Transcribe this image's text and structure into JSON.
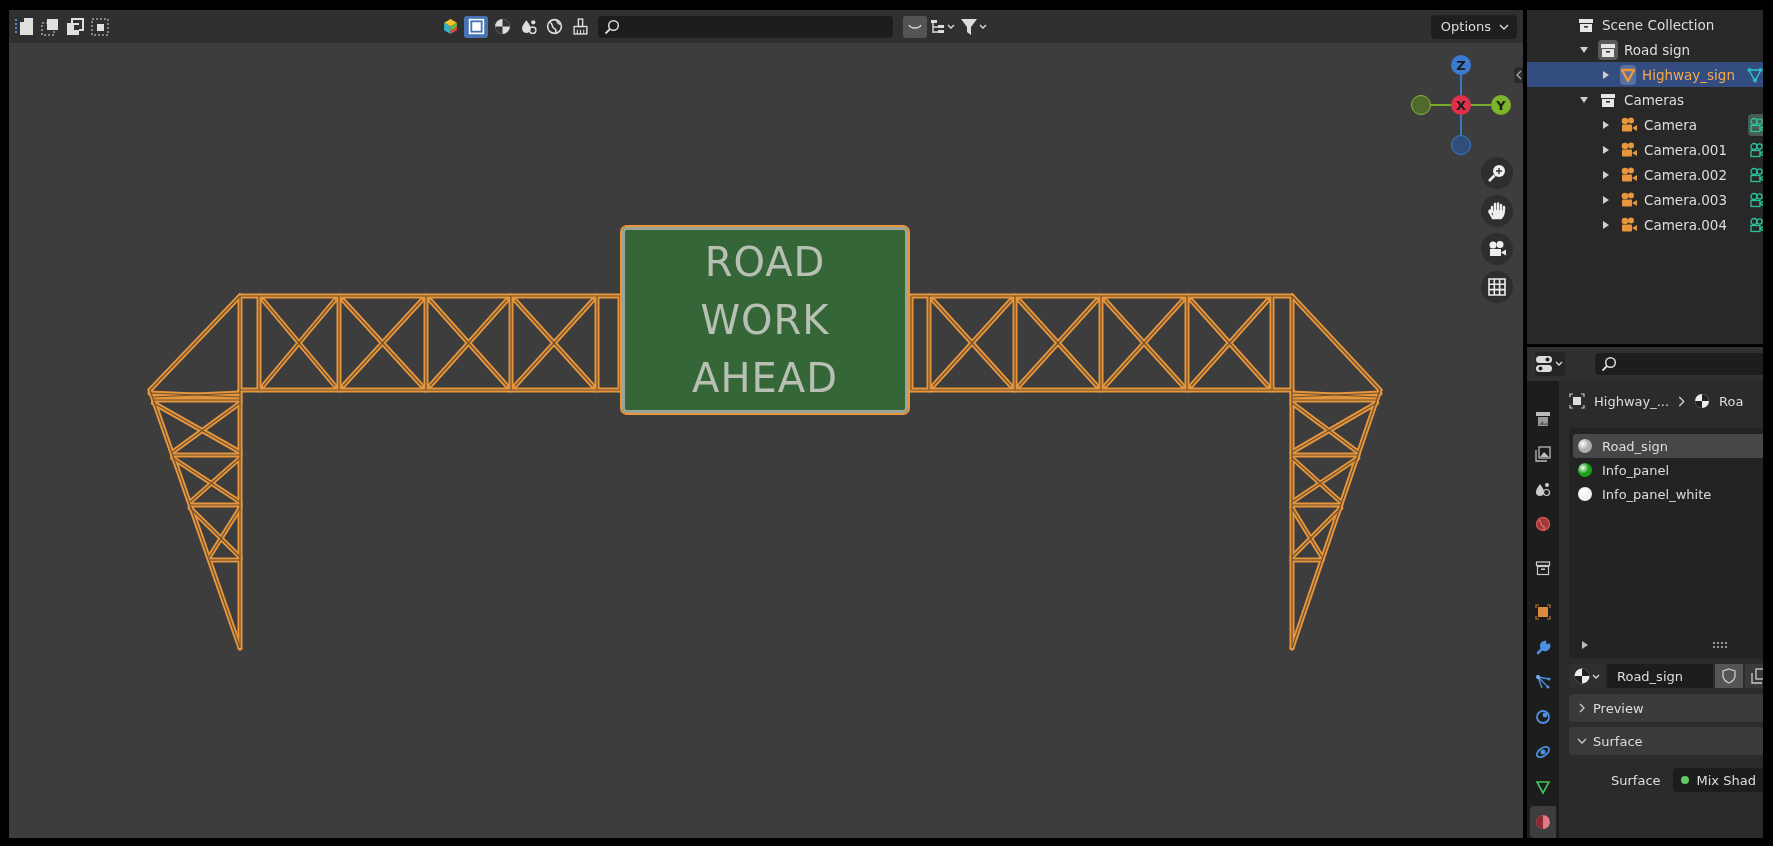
{
  "viewport_header": {
    "tool_buttons": [
      {
        "kind": "gizmo",
        "selected": false
      },
      {
        "kind": "xray",
        "selected": true
      },
      {
        "kind": "solid",
        "selected": false
      },
      {
        "kind": "material",
        "selected": false
      },
      {
        "kind": "world",
        "selected": false
      },
      {
        "kind": "brush",
        "selected": false
      }
    ],
    "options": "Options"
  },
  "sign": {
    "lines": [
      "ROAD",
      "WORK",
      "AHEAD"
    ]
  },
  "gizmo": {
    "axes": [
      "Z",
      "X",
      "Y"
    ]
  },
  "outliner": {
    "items": [
      {
        "name": "Scene Collection",
        "kind": "collection",
        "selected": false,
        "icon_active": false,
        "children": [
          {
            "name": "Road sign",
            "kind": "collection",
            "selected": false,
            "icon_active": true,
            "expanded": true,
            "children": [
              {
                "name": "Highway_sign",
                "kind": "mesh",
                "selected": true,
                "icon_active": true,
                "expanded": false,
                "data_active": false
              }
            ]
          },
          {
            "name": "Cameras",
            "kind": "collection",
            "selected": false,
            "icon_active": false,
            "expanded": true,
            "children": [
              {
                "name": "Camera",
                "kind": "camera",
                "selected": false,
                "icon_active": false,
                "expanded": false,
                "data_active": true
              },
              {
                "name": "Camera.001",
                "kind": "camera",
                "selected": false,
                "icon_active": false,
                "expanded": false,
                "data_active": false
              },
              {
                "name": "Camera.002",
                "kind": "camera",
                "selected": false,
                "icon_active": false,
                "expanded": false,
                "data_active": false
              },
              {
                "name": "Camera.003",
                "kind": "camera",
                "selected": false,
                "icon_active": false,
                "expanded": false,
                "data_active": false
              },
              {
                "name": "Camera.004",
                "kind": "camera",
                "selected": false,
                "icon_active": false,
                "expanded": false,
                "data_active": false
              }
            ]
          }
        ]
      }
    ]
  },
  "properties": {
    "tabs": [
      {
        "kind": "render",
        "selected": false
      },
      {
        "kind": "output",
        "selected": false
      },
      {
        "kind": "scene",
        "selected": false
      },
      {
        "kind": "world",
        "selected": false
      },
      {
        "kind": "collection",
        "selected": false
      },
      {
        "kind": "object",
        "selected": false
      },
      {
        "kind": "modifiers",
        "selected": false
      },
      {
        "kind": "particles",
        "selected": false
      },
      {
        "kind": "physics",
        "selected": false
      },
      {
        "kind": "constraints",
        "selected": false
      },
      {
        "kind": "data",
        "selected": false
      },
      {
        "kind": "material",
        "selected": true
      }
    ],
    "breadcrumb": [
      "Highway_...",
      "Roa"
    ],
    "material_slots": [
      {
        "name": "Road_sign",
        "color": "#b0b0b0",
        "selected": true
      },
      {
        "name": "Info_panel",
        "color": "#1aa31a",
        "selected": false
      },
      {
        "name": "Info_panel_white",
        "color": "#f2f2f2",
        "selected": false
      }
    ],
    "material_name": "Road_sign",
    "panels": [
      {
        "title": "Preview",
        "expanded": false
      },
      {
        "title": "Surface",
        "expanded": true
      }
    ],
    "surface_field": {
      "label": "Surface",
      "value": "Mix Shad"
    }
  }
}
